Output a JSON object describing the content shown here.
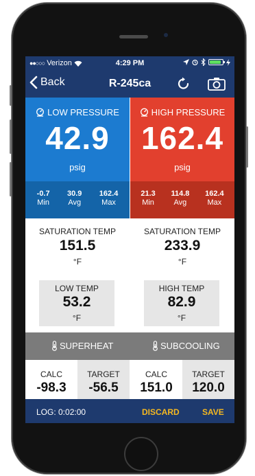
{
  "status_bar": {
    "carrier": "Verizon",
    "time": "4:29 PM",
    "signal_dots": "●●○○○",
    "battery_level": 0.9
  },
  "nav": {
    "back_label": "Back",
    "title": "R-245ca",
    "icons": {
      "back": "chevron-left-icon",
      "refresh": "refresh-icon",
      "camera": "camera-icon"
    }
  },
  "low_pressure": {
    "title": "LOW PRESSURE",
    "value": "42.9",
    "unit": "psig",
    "color": "#1c7bd0",
    "stats": [
      {
        "value": "-0.7",
        "label": "Min"
      },
      {
        "value": "30.9",
        "label": "Avg"
      },
      {
        "value": "162.4",
        "label": "Max"
      }
    ]
  },
  "high_pressure": {
    "title": "HIGH PRESSURE",
    "value": "162.4",
    "unit": "psig",
    "color": "#e2402e",
    "stats": [
      {
        "value": "21.3",
        "label": "Min"
      },
      {
        "value": "114.8",
        "label": "Avg"
      },
      {
        "value": "162.4",
        "label": "Max"
      }
    ]
  },
  "saturation": {
    "left": {
      "label": "SATURATION TEMP",
      "value": "151.5",
      "unit": "°F"
    },
    "right": {
      "label": "SATURATION TEMP",
      "value": "233.9",
      "unit": "°F"
    }
  },
  "temps": {
    "low": {
      "label": "LOW TEMP",
      "value": "53.2",
      "unit": "°F"
    },
    "high": {
      "label": "HIGH TEMP",
      "value": "82.9",
      "unit": "°F"
    }
  },
  "modes": {
    "superheat": "SUPERHEAT",
    "subcooling": "SUBCOOLING"
  },
  "calc": [
    {
      "label": "CALC",
      "value": "-98.3"
    },
    {
      "label": "TARGET",
      "value": "-56.5"
    },
    {
      "label": "CALC",
      "value": "151.0"
    },
    {
      "label": "TARGET",
      "value": "120.0"
    }
  ],
  "log": {
    "time_label": "LOG: 0:02:00",
    "discard": "DISCARD",
    "save": "SAVE",
    "accent": "#f5b820"
  }
}
